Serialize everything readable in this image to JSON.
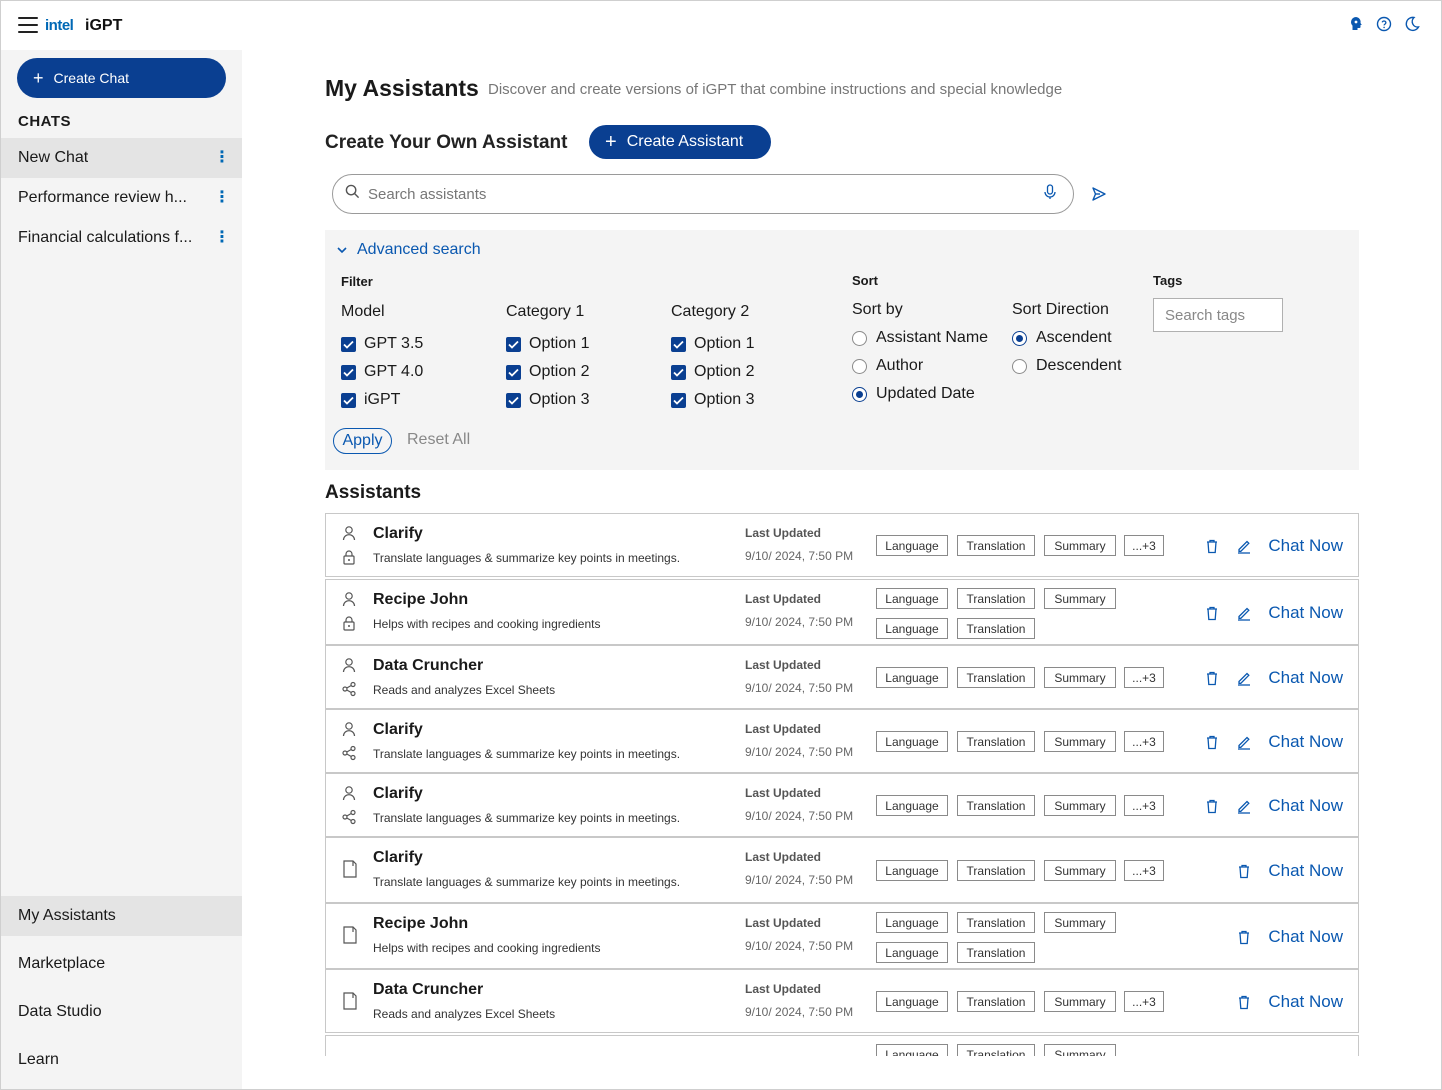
{
  "header": {
    "brand": "intel",
    "app_name": "iGPT"
  },
  "sidebar": {
    "create_chat_label": "Create Chat",
    "chats_title": "CHATS",
    "chats": [
      {
        "label": "New Chat"
      },
      {
        "label": "Performance review h..."
      },
      {
        "label": "Financial calculations f..."
      }
    ],
    "nav": [
      {
        "label": "My Assistants"
      },
      {
        "label": "Marketplace"
      },
      {
        "label": "Data Studio"
      },
      {
        "label": "Learn"
      }
    ]
  },
  "main": {
    "title": "My Assistants",
    "subtitle": "Discover and create versions of iGPT that combine instructions and special knowledge",
    "create_own_title": "Create Your Own Assistant",
    "create_assistant_label": "Create Assistant",
    "search_placeholder": "Search assistants",
    "advanced": {
      "toggle_label": "Advanced search",
      "filter_label": "Filter",
      "sort_label": "Sort",
      "tags_label": "Tags",
      "columns": [
        {
          "title": "Model",
          "options": [
            "GPT 3.5",
            "GPT 4.0",
            "iGPT"
          ]
        },
        {
          "title": "Category 1",
          "options": [
            "Option 1",
            "Option 2",
            "Option 3"
          ]
        },
        {
          "title": "Category 2",
          "options": [
            "Option 1",
            "Option 2",
            "Option 3"
          ]
        }
      ],
      "sort_by_title": "Sort by",
      "sort_by_options": [
        "Assistant Name",
        "Author",
        "Updated Date"
      ],
      "sort_by_selected": "Updated Date",
      "sort_dir_title": "Sort Direction",
      "sort_dir_options": [
        "Ascendent",
        "Descendent"
      ],
      "sort_dir_selected": "Ascendent",
      "tags_placeholder": "Search tags",
      "apply_label": "Apply",
      "reset_label": "Reset All"
    },
    "assistants_title": "Assistants",
    "last_updated_label": "Last Updated",
    "chat_now_label": "Chat Now",
    "tag_more": "...+3",
    "assistants": [
      {
        "name": "Clarify",
        "desc": "Translate languages & summarize key points in meetings.",
        "date": "9/10/ 2024, 7:50 PM",
        "icon2": "lock-icon",
        "layout": "single",
        "editable": true
      },
      {
        "name": "Recipe John",
        "desc": "Helps with recipes and cooking ingredients",
        "date": "9/10/ 2024, 7:50 PM",
        "icon2": "lock-icon",
        "layout": "double",
        "editable": true
      },
      {
        "name": "Data Cruncher",
        "desc": "Reads and analyzes Excel Sheets",
        "date": "9/10/ 2024, 7:50 PM",
        "icon2": "share-icon",
        "layout": "single",
        "editable": true
      },
      {
        "name": "Clarify",
        "desc": "Translate languages & summarize key points in meetings.",
        "date": "9/10/ 2024, 7:50 PM",
        "icon2": "share-icon",
        "layout": "single",
        "editable": true
      },
      {
        "name": "Clarify",
        "desc": "Translate languages & summarize key points in meetings.",
        "date": "9/10/ 2024, 7:50 PM",
        "icon2": "share-icon",
        "layout": "single",
        "editable": true
      },
      {
        "name": "Clarify",
        "desc": "Translate languages & summarize key points in meetings.",
        "date": "9/10/ 2024, 7:50 PM",
        "icon2": "document-icon",
        "layout": "single",
        "editable": false
      },
      {
        "name": "Recipe John",
        "desc": "Helps with recipes and cooking ingredients",
        "date": "9/10/ 2024, 7:50 PM",
        "icon2": "document-icon",
        "layout": "double",
        "editable": false
      },
      {
        "name": "Data Cruncher",
        "desc": "Reads and analyzes Excel Sheets",
        "date": "9/10/ 2024, 7:50 PM",
        "icon2": "document-icon",
        "layout": "single",
        "editable": false
      },
      {
        "name": "",
        "desc": "",
        "date": "",
        "icon2": "none",
        "layout": "partial",
        "editable": false
      }
    ],
    "tags_row1": [
      "Language",
      "Translation",
      "Summary"
    ],
    "tags_row2": [
      "Language",
      "Translation"
    ]
  },
  "colors": {
    "brand_blue": "#0a3f91",
    "link_blue": "#0a58b0",
    "sidebar_bg": "#f4f4f4"
  }
}
